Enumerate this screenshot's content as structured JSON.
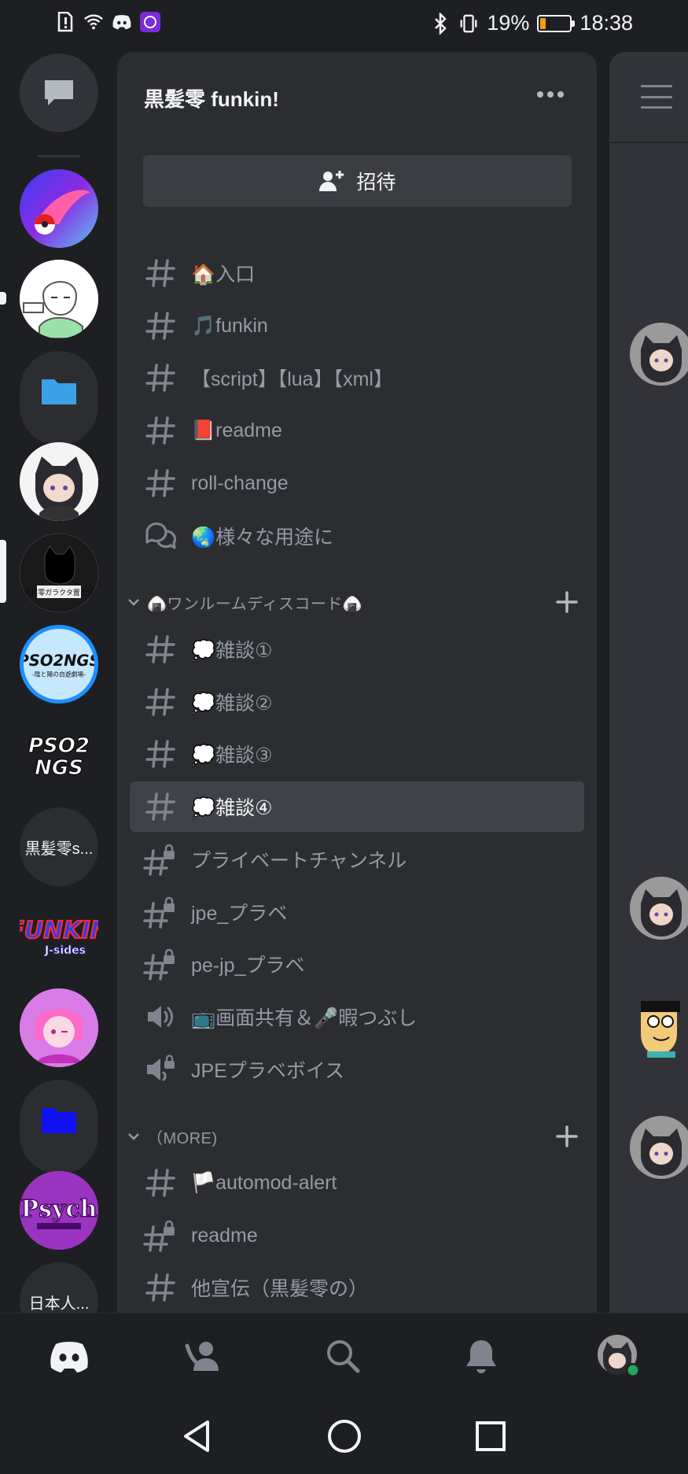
{
  "status_bar": {
    "battery_percent": "19%",
    "battery_level": 0.19,
    "time": "18:38",
    "left_icons": [
      "alert-icon",
      "wifi-icon",
      "discord-icon",
      "app-icon"
    ],
    "right_icons": [
      "bluetooth-icon",
      "vibrate-icon"
    ]
  },
  "rail": {
    "servers": [
      {
        "kind": "dm",
        "icon": "chat-bubble-icon"
      },
      {
        "kind": "server",
        "icon": "pokeball-comet-icon"
      },
      {
        "kind": "server",
        "icon": "sketch-avatar-icon",
        "unread": true
      },
      {
        "kind": "folder",
        "icon": "folder-icon",
        "color": "#3ba0e6"
      },
      {
        "kind": "server",
        "icon": "cat-girl-avatar-icon"
      },
      {
        "kind": "server",
        "icon": "black-cat-logo-icon",
        "selected": true,
        "label": "黒髪零 ガラクタ置き場"
      },
      {
        "kind": "server",
        "icon": "pso2ngs-logo-icon",
        "label": "PSO2NGS",
        "sublabel": "-陰と陽の自遊劇場-"
      },
      {
        "kind": "server",
        "icon": "pso2ngs-text-icon",
        "label": "PSO2 NGS"
      },
      {
        "kind": "text",
        "label": "黒髪零s..."
      },
      {
        "kind": "server",
        "icon": "funkin-logo-icon",
        "label": "FUNKIN",
        "sublabel": "J-sides"
      },
      {
        "kind": "server",
        "icon": "pink-anime-avatar-icon"
      },
      {
        "kind": "folder",
        "icon": "folder-icon",
        "color": "#1010f0"
      },
      {
        "kind": "server",
        "icon": "psych-engine-logo-icon",
        "label": "Psych"
      },
      {
        "kind": "text",
        "label": "日本人..."
      }
    ]
  },
  "panel": {
    "guild_name": "黒髪零 funkin!",
    "invite_label": "招待",
    "channels_top": [
      {
        "type": "text",
        "name": "🏠入口"
      },
      {
        "type": "text",
        "name": "🎵funkin"
      },
      {
        "type": "text",
        "name": "【script】【lua】【xml】"
      },
      {
        "type": "text",
        "name": "📕readme"
      },
      {
        "type": "text",
        "name": "roll-change"
      },
      {
        "type": "forum",
        "name": "🌏様々な用途に"
      }
    ],
    "category1": {
      "label": "🍙ワンルームディスコード🍙"
    },
    "channels_cat1": [
      {
        "type": "text",
        "name": "💭雑談①"
      },
      {
        "type": "text",
        "name": "💭雑談②"
      },
      {
        "type": "text",
        "name": "💭雑談③"
      },
      {
        "type": "text",
        "name": "💭雑談④",
        "selected": true
      },
      {
        "type": "private",
        "name": "プライベートチャンネル"
      },
      {
        "type": "private",
        "name": "jpe_プラベ"
      },
      {
        "type": "private",
        "name": "pe-jp_プラベ"
      },
      {
        "type": "voice",
        "name": "📺画面共有＆🎤暇つぶし"
      },
      {
        "type": "voice-locked",
        "name": "JPEプラベボイス"
      }
    ],
    "category2": {
      "label": "（MORE)"
    },
    "channels_cat2": [
      {
        "type": "text",
        "name": "🏳️automod-alert"
      },
      {
        "type": "private",
        "name": "readme"
      },
      {
        "type": "text",
        "name": "他宣伝（黒髪零の）"
      }
    ]
  },
  "bottom_nav": {
    "items": [
      "discord-home-icon",
      "friends-icon",
      "search-icon",
      "notifications-bell-icon",
      "profile-avatar-icon"
    ]
  },
  "system_nav": {
    "items": [
      "back-triangle-icon",
      "home-circle-icon",
      "recents-square-icon"
    ]
  },
  "colors": {
    "background": "#1e1f22",
    "panel": "#2b2d31",
    "selected": "#404249",
    "muted_text": "#949ba4",
    "online": "#23a55a"
  }
}
